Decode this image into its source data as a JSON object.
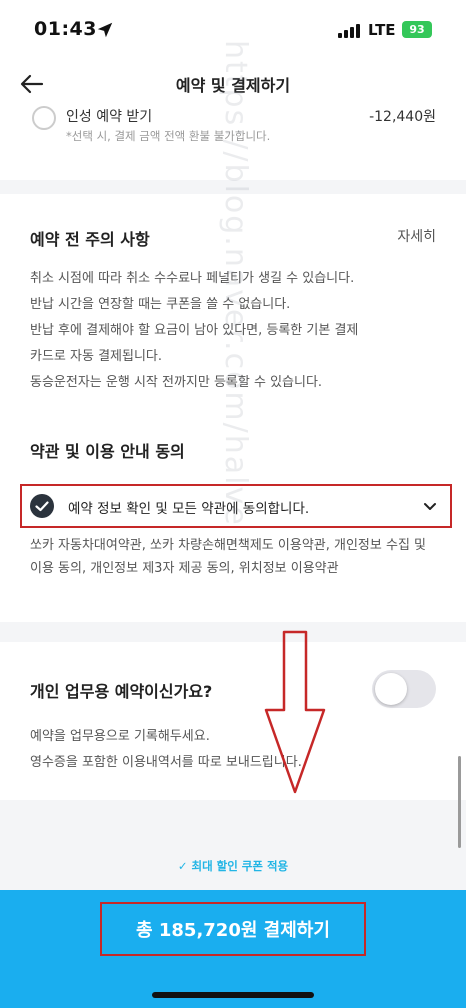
{
  "status_bar": {
    "time": "01:43",
    "network": "LTE",
    "battery": "93"
  },
  "header": {
    "title": "예약 및 결제하기"
  },
  "discount_option": {
    "label": "인성 예약 받기",
    "amount": "-12,440원",
    "note": "*선택 시, 결제 금액 전액 환불 불가합니다."
  },
  "notice": {
    "title": "예약 전 주의 사항",
    "more_label": "자세히",
    "lines": [
      "취소 시점에 따라 취소 수수료나 페널티가 생길 수 있습니다.",
      "반납 시간을 연장할 때는 쿠폰을 쓸 수 없습니다.",
      "반납 후에 결제해야 할 요금이 남아 있다면, 등록한 기본 결제",
      "카드로 자동 결제됩니다.",
      "동승운전자는 운행 시작 전까지만 등록할 수 있습니다."
    ]
  },
  "terms": {
    "title": "약관 및 이용 안내 동의",
    "agree_all": "예약 정보 확인 및 모든 약관에 동의합니다.",
    "list": "쏘카 자동차대여약관, 쏘카 차량손해면책제도 이용약관, 개인정보 수집 및 이용 동의, 개인정보 제3자 제공 동의, 위치정보 이용약관"
  },
  "business": {
    "title": "개인 업무용 예약이신가요?",
    "toggle_on": false,
    "desc_lines": [
      "예약을 업무용으로 기록해두세요.",
      "영수증을 포함한 이용내역서를 따로 보내드립니다."
    ]
  },
  "coupon_note": "✓ 최대 할인 쿠폰 적용",
  "pay_button": {
    "label": "총 185,720원 결제하기"
  },
  "watermark": "https://blog.naver.com/halve",
  "colors": {
    "accent": "#1aaeef",
    "annotation": "#c62828",
    "toggle_off": "#e5e5ea"
  }
}
